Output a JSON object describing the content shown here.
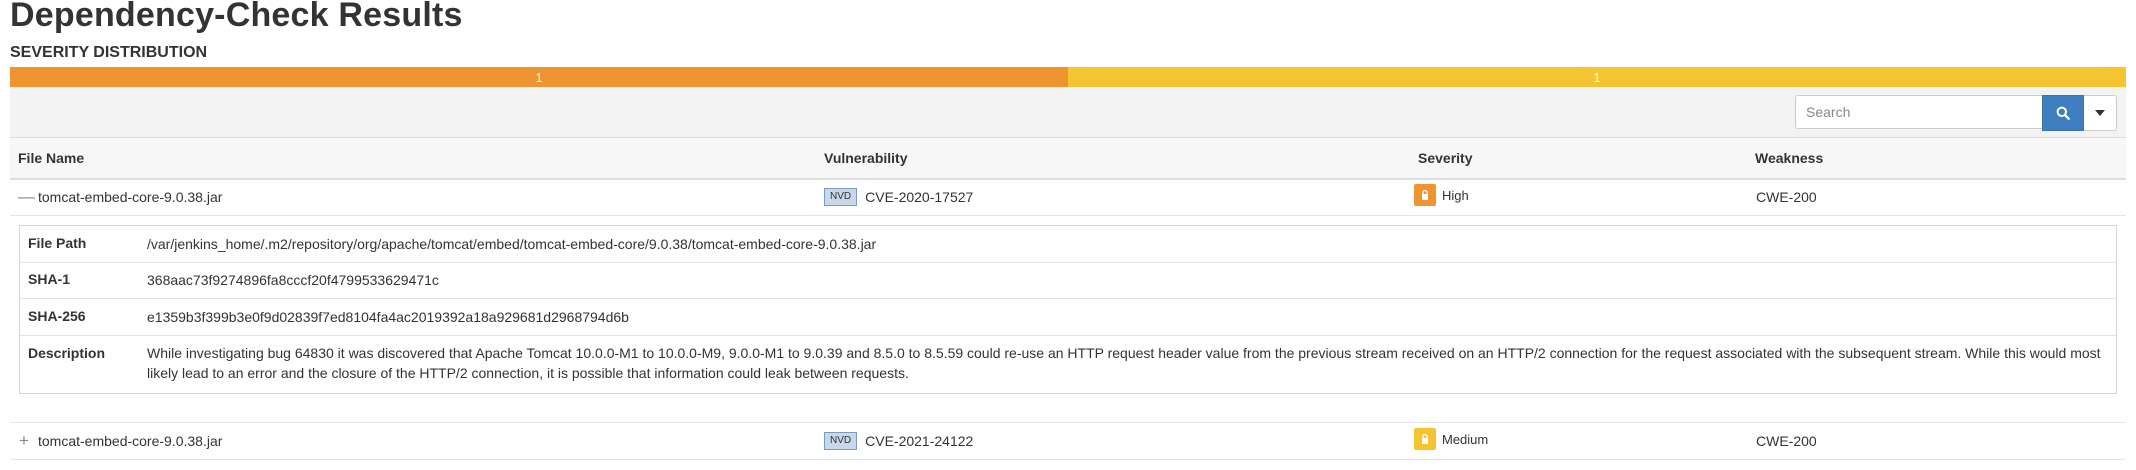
{
  "page": {
    "title": "Dependency-Check Results"
  },
  "severity_distribution": {
    "title": "SEVERITY DISTRIBUTION",
    "segments": [
      {
        "label": "1",
        "count": 1,
        "color": "#ef9430"
      },
      {
        "label": "1",
        "count": 1,
        "color": "#f5c431"
      }
    ]
  },
  "search": {
    "placeholder": "Search",
    "value": ""
  },
  "table": {
    "columns": [
      "File Name",
      "Vulnerability",
      "Severity",
      "Weakness"
    ],
    "rows": [
      {
        "toggle": "—",
        "file_name": "tomcat-embed-core-9.0.38.jar",
        "source_badge": "NVD",
        "vulnerability": "CVE-2020-17527",
        "severity": "High",
        "severity_color": "#ef9430",
        "weakness": "CWE-200"
      },
      {
        "toggle": "+",
        "file_name": "tomcat-embed-core-9.0.38.jar",
        "source_badge": "NVD",
        "vulnerability": "CVE-2021-24122",
        "severity": "Medium",
        "severity_color": "#f5c431",
        "weakness": "CWE-200"
      }
    ]
  },
  "details": {
    "file_path_label": "File Path",
    "file_path": "/var/jenkins_home/.m2/repository/org/apache/tomcat/embed/tomcat-embed-core/9.0.38/tomcat-embed-core-9.0.38.jar",
    "sha1_label": "SHA-1",
    "sha1": "368aac73f9274896fa8cccf20f4799533629471c",
    "sha256_label": "SHA-256",
    "sha256": "e1359b3f399b3e0f9d02839f7ed8104fa4ac2019392a18a929681d2968794d6b",
    "description_label": "Description",
    "description": "While investigating bug 64830 it was discovered that Apache Tomcat 10.0.0-M1 to 10.0.0-M9, 9.0.0-M1 to 9.0.39 and 8.5.0 to 8.5.59 could re-use an HTTP request header value from the previous stream received on an HTTP/2 connection for the request associated with the subsequent stream. While this would most likely lead to an error and the closure of the HTTP/2 connection, it is possible that information could leak between requests."
  }
}
